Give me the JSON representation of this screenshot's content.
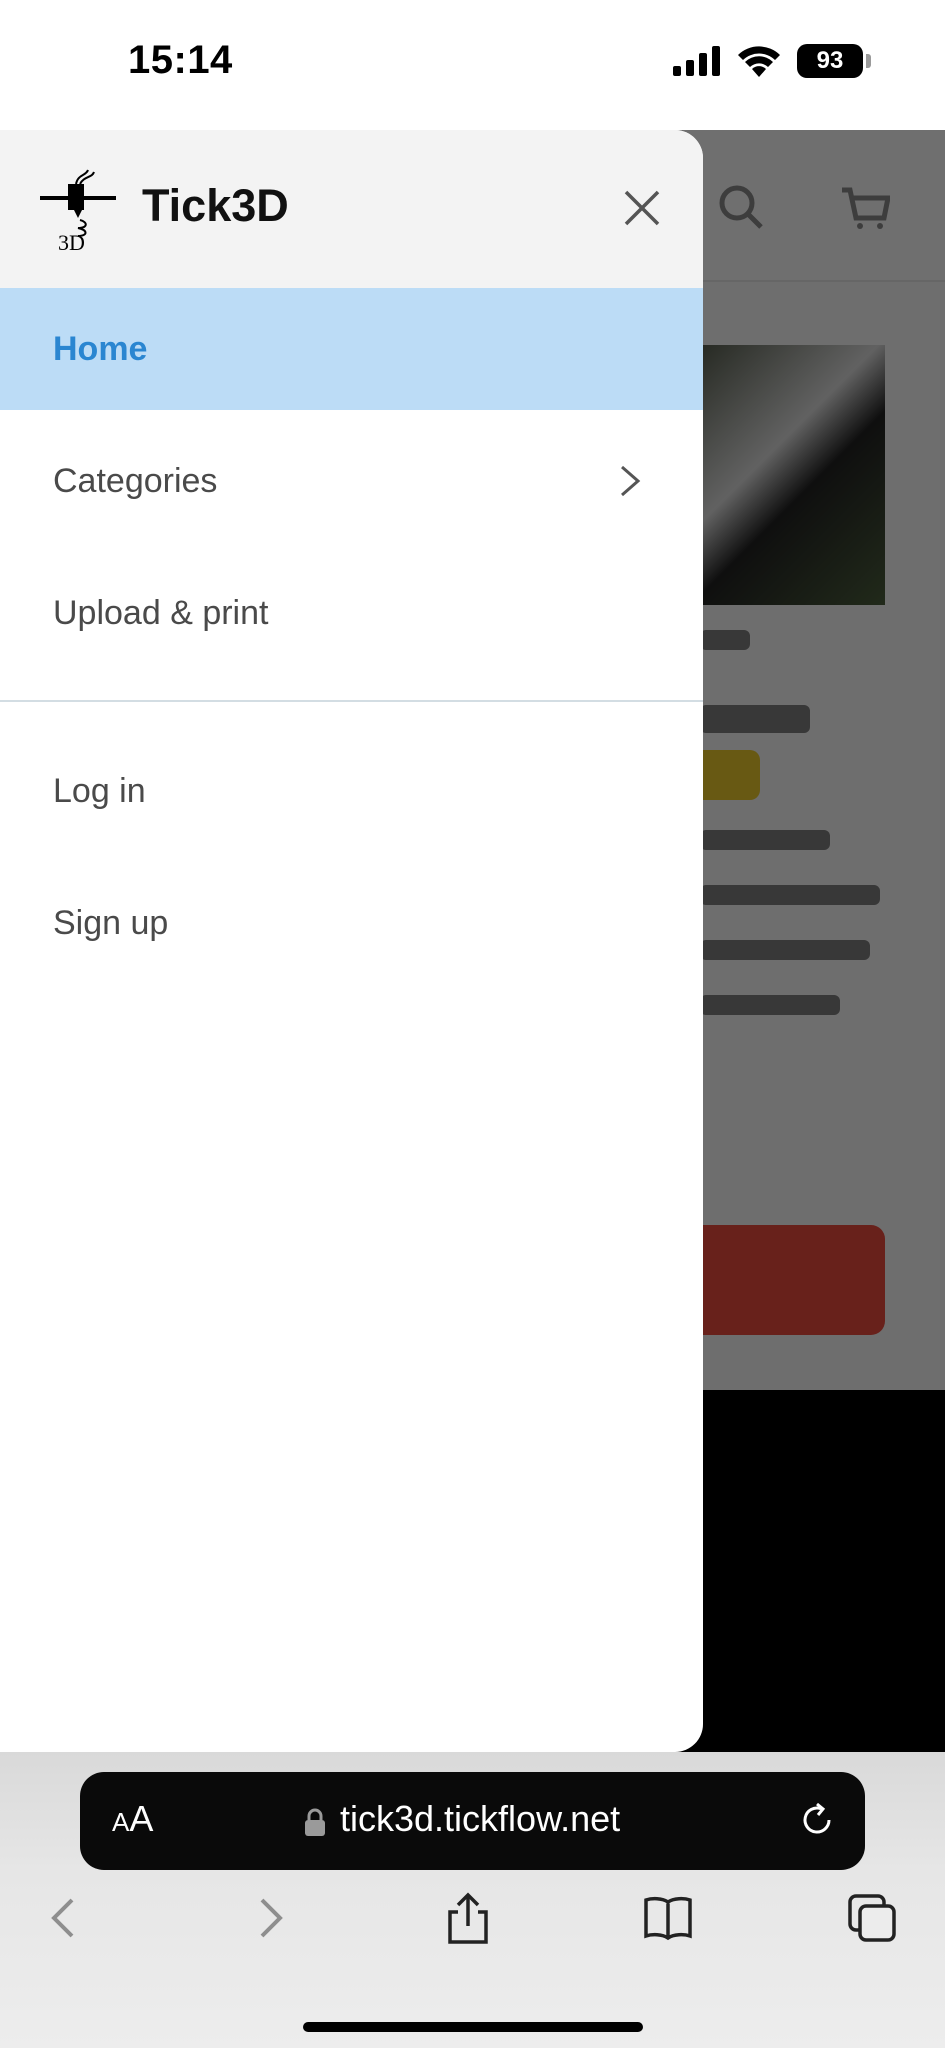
{
  "status_bar": {
    "time": "15:14",
    "battery": "93"
  },
  "drawer": {
    "brand": "Tick3D",
    "logo_text": "3D",
    "menu": [
      {
        "label": "Home",
        "active": true
      },
      {
        "label": "Categories",
        "has_submenu": true
      },
      {
        "label": "Upload & print"
      }
    ],
    "account": [
      {
        "label": "Log in"
      },
      {
        "label": "Sign up"
      }
    ]
  },
  "browser": {
    "text_size_label": "AA",
    "url": "tick3d.tickflow.net"
  },
  "colors": {
    "active_bg": "#bcdcf6",
    "active_text": "#2a86d1"
  }
}
